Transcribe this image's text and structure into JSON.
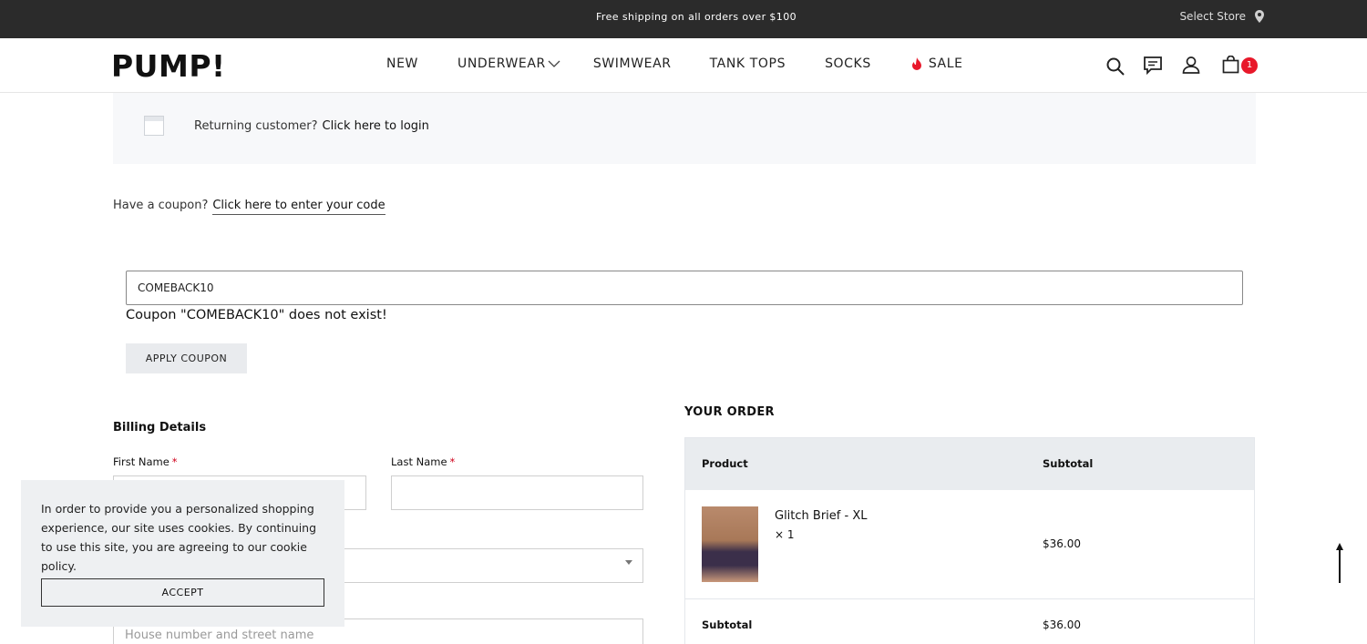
{
  "topbar": {
    "promo": "Free shipping on all orders over $100",
    "store_label": "Select Store",
    "store_icon": "map-pin-icon"
  },
  "header": {
    "logo": "PUMP!",
    "nav": [
      "NEW",
      "UNDERWEAR",
      "SWIMWEAR",
      "TANK TOPS",
      "SOCKS",
      "SALE"
    ],
    "icons": [
      "search-icon",
      "blog-icon",
      "account-icon",
      "cart-icon"
    ],
    "cart_count": "1"
  },
  "login": {
    "prompt": "Returning customer?",
    "link": "Click here to login"
  },
  "coupon": {
    "prompt": "Have a coupon?",
    "link": "Click here to enter your code",
    "input_value": "COMEBACK10",
    "error": "Coupon \"COMEBACK10\" does not exist!",
    "apply_label": "APPLY COUPON"
  },
  "billing": {
    "title": "Billing Details",
    "first_name_label": "First Name",
    "last_name_label": "Last Name",
    "required_mark": "*",
    "street_placeholder": "House number and street name"
  },
  "order": {
    "title": "YOUR ORDER",
    "col_product": "Product",
    "col_subtotal": "Subtotal",
    "items": [
      {
        "name": "Glitch Brief - XL",
        "qty": "× 1",
        "price": "$36.00"
      }
    ],
    "subtotal_label": "Subtotal",
    "subtotal_value": "$36.00"
  },
  "cookie": {
    "text": "In order to provide you a personalized shopping experience, our site uses cookies. By continuing to use this site, you are agreeing to our cookie policy.",
    "accept": "ACCEPT"
  },
  "colors": {
    "topbar_bg": "#2b2b2b",
    "badge": "#e8182a",
    "sale_flame": "#e8182a",
    "panel_bg": "#f7f8fa",
    "table_head_bg": "#e9ecef"
  }
}
